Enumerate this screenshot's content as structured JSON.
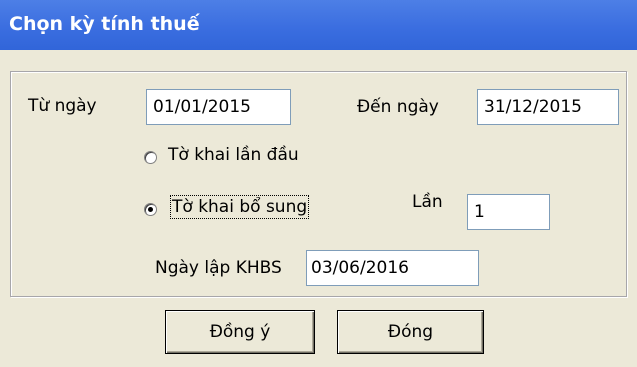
{
  "window": {
    "title": "Chọn kỳ tính thuế"
  },
  "period": {
    "from_label": "Từ ngày",
    "from_value": "01/01/2015",
    "to_label": "Đến ngày",
    "to_value": "31/12/2015"
  },
  "declaration_type": {
    "options": [
      {
        "label": "Tờ khai lần đầu",
        "selected": false
      },
      {
        "label": "Tờ khai bổ sung",
        "selected": true
      }
    ],
    "times_label": "Lần",
    "times_value": "1"
  },
  "khbs_date": {
    "label": "Ngày lập KHBS",
    "value": "03/06/2016"
  },
  "buttons": {
    "ok": "Đồng ý",
    "close": "Đóng"
  }
}
